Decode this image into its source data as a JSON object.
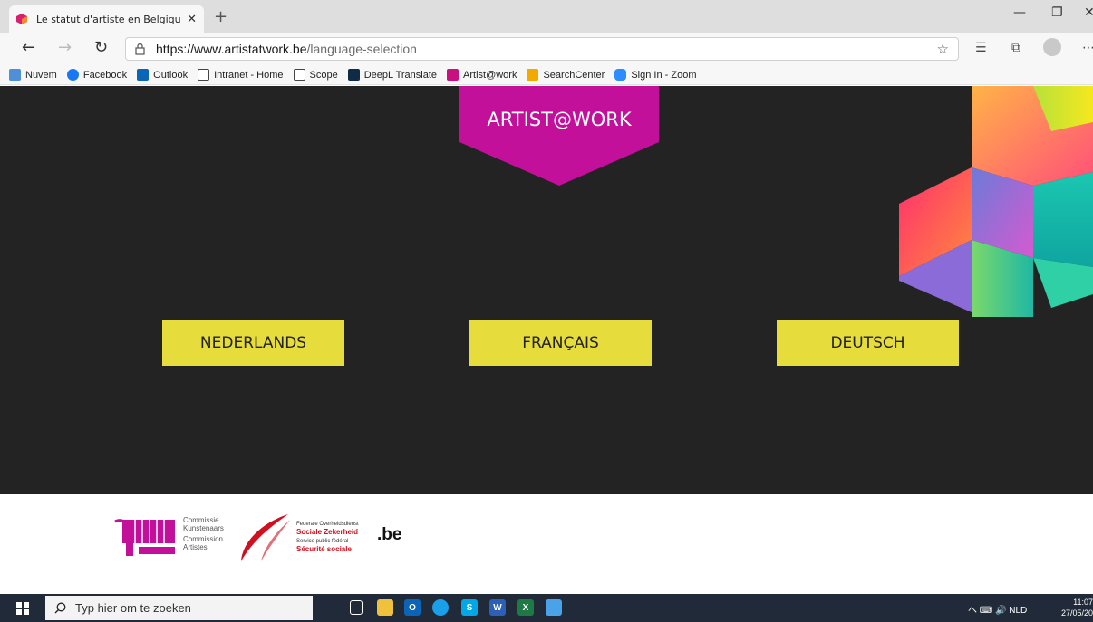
{
  "browser": {
    "tab": {
      "title": "Le statut d'artiste en Belgique | Artist@work",
      "close_glyph": "✕"
    },
    "new_tab_glyph": "+",
    "address": {
      "host": "https://www.artistatwork.be",
      "path": "/language-selection"
    },
    "window_controls": {
      "minimize": "—",
      "restore": "❐",
      "close": "✕"
    }
  },
  "favorites": [
    {
      "label": "Nuvem",
      "icon": "folder-icon",
      "color": "#4f8fd8"
    },
    {
      "label": "Facebook",
      "icon": "facebook-icon",
      "color": "#1877f2"
    },
    {
      "label": "Outlook",
      "icon": "outlook-icon",
      "color": "#0a64b8"
    },
    {
      "label": "Intranet - Home",
      "icon": "page-icon",
      "color": "#ffffff"
    },
    {
      "label": "Scope",
      "icon": "page-icon",
      "color": "#ffffff"
    },
    {
      "label": "DeepL Translate",
      "icon": "deepl-icon",
      "color": "#0f2b46"
    },
    {
      "label": "Artist@work",
      "icon": "artist-icon",
      "color": "#c8107f"
    },
    {
      "label": "SearchCenter",
      "icon": "searchcenter-icon",
      "color": "#f2a900"
    },
    {
      "label": "Sign In - Zoom",
      "icon": "zoom-icon",
      "color": "#2d8cff"
    }
  ],
  "page": {
    "logo_text": "ARTIST@WORK",
    "logo_color": "#c3109a",
    "button_color": "#e6dd3c",
    "languages": [
      "NEDERLANDS",
      "FRANÇAIS",
      "DEUTSCH"
    ]
  },
  "footer": {
    "commission": {
      "lines": [
        "Commissie",
        "Kunstenaars",
        "Commission",
        "Artistes"
      ],
      "color": "#c3109a"
    },
    "social_security": {
      "line1": "Federale Overheidsdienst",
      "line2": "Sociale Zekerheid",
      "line3": "Service public fédéral",
      "line4": "Sécurité sociale"
    },
    "be_logo": ".be"
  },
  "taskbar": {
    "search_placeholder": "Typ hier om te zoeken",
    "tray_text": "へ  ⌨  🔊  NLD",
    "time": "11:07",
    "date": "27/05/20"
  }
}
